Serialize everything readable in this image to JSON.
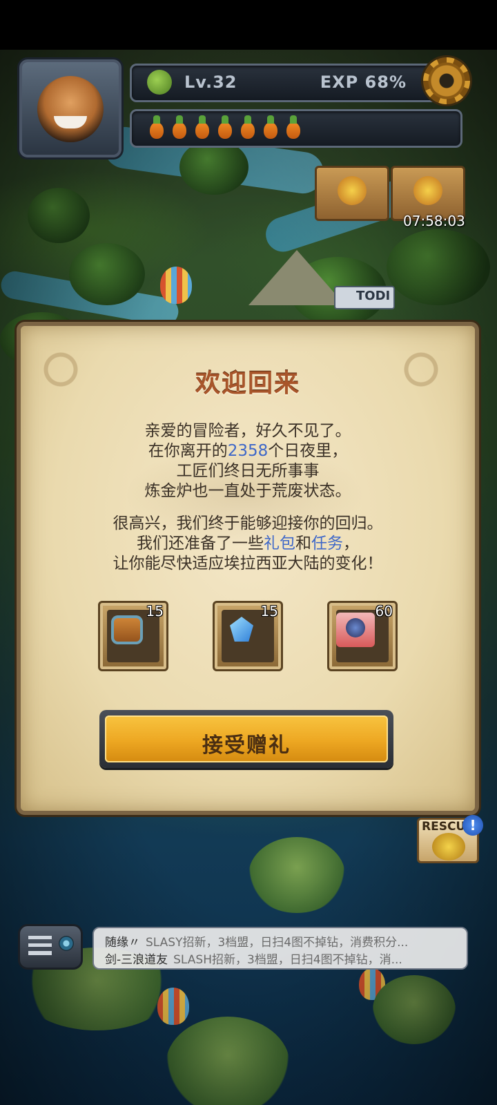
{
  "hud": {
    "level": "Lv.32",
    "exp": "EXP 68%",
    "stamina_count": 7,
    "timer": "07:58:03",
    "todo_label": "TODI"
  },
  "dialog": {
    "title": "欢迎回来",
    "p1": {
      "line1": "亲爱的冒险者，好久不见了。",
      "line2_pre": "在你离开的",
      "line2_days": "2358",
      "line2_post": "个日夜里，",
      "line3": "工匠们终日无所事事",
      "line4": "炼金炉也一直处于荒废状态。"
    },
    "p2": {
      "line1": "很高兴，我们终于能够迎接你的回归。",
      "line2_pre": "我们还准备了一些",
      "line2_gift": "礼包",
      "line2_mid": "和",
      "line2_task": "任务",
      "line2_post": "，",
      "line3": "让你能尽快适应埃拉西亚大陆的变化！"
    },
    "gifts": [
      {
        "icon": "backpack-icon",
        "count": "15"
      },
      {
        "icon": "crystal-icon",
        "count": "15"
      },
      {
        "icon": "puzzle-icon",
        "count": "60"
      }
    ],
    "accept_label": "接受赠礼"
  },
  "rescue": {
    "label": "RESCU",
    "alert": "!"
  },
  "chat": {
    "messages": [
      {
        "name": "随缘〃",
        "text": "SLASY招新，3档盟，日扫4图不掉钻，消费积分..."
      },
      {
        "name": "剑-三浪道友",
        "text": "SLASH招新，3档盟，日扫4图不掉钻，消..."
      }
    ]
  },
  "colors": {
    "accent": "#f0b42a",
    "title": "#a8552a",
    "highlight": "#3e67c8",
    "parchment": "#efe0ba"
  }
}
